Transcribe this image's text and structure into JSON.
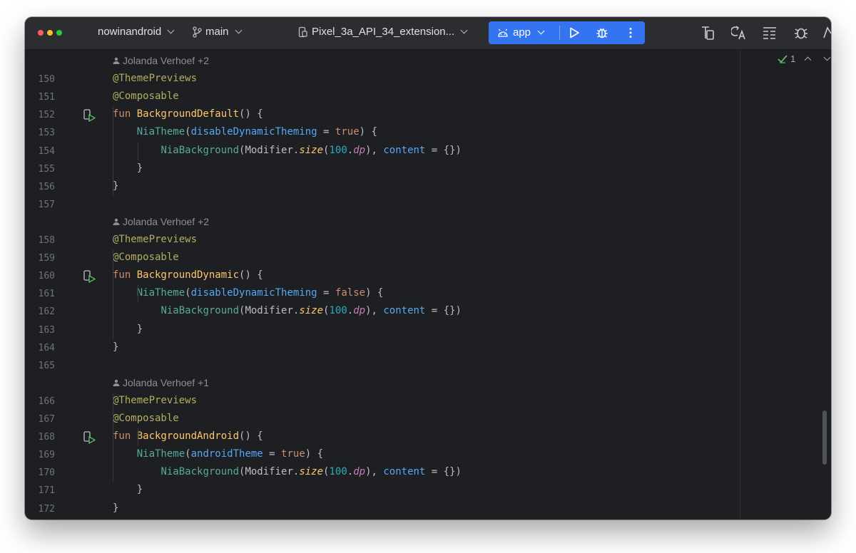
{
  "titlebar": {
    "project": "nowinandroid",
    "branch": "main",
    "device": "Pixel_3a_API_34_extension...",
    "run_config": "app"
  },
  "toolbar_icons": [
    "run-icon",
    "debug-icon",
    "more-icon",
    "device-manager-icon",
    "translate-icon",
    "code-structure-icon",
    "bug-icon",
    "profile-icon"
  ],
  "inspection": {
    "count": "1"
  },
  "author_blocks": [
    {
      "label": "Jolanda Verhoef +2"
    },
    {
      "label": "Jolanda Verhoef +2"
    },
    {
      "label": "Jolanda Verhoef +1"
    }
  ],
  "lines": [
    {
      "no": "150",
      "tokens": [
        [
          "@ThemePreviews",
          "ann"
        ]
      ]
    },
    {
      "no": "151",
      "tokens": [
        [
          "@Composable",
          "ann"
        ]
      ]
    },
    {
      "no": "152",
      "tokens": [
        [
          "fun ",
          "kw"
        ],
        [
          "BackgroundDefault",
          "fndecl"
        ],
        [
          "() {",
          "plain"
        ]
      ]
    },
    {
      "no": "153",
      "tokens": [
        [
          "    ",
          "plain"
        ],
        [
          "NiaTheme",
          "call"
        ],
        [
          "(",
          "plain"
        ],
        [
          "disableDynamicTheming",
          "param"
        ],
        [
          " = ",
          "plain"
        ],
        [
          "true",
          "kw"
        ],
        [
          ") {",
          "plain"
        ]
      ]
    },
    {
      "no": "154",
      "tokens": [
        [
          "        ",
          "plain"
        ],
        [
          "NiaBackground",
          "call"
        ],
        [
          "(Modifier.",
          "plain"
        ],
        [
          "size",
          "ital"
        ],
        [
          "(",
          "plain"
        ],
        [
          "100",
          "num"
        ],
        [
          ".",
          "plain"
        ],
        [
          "dp",
          "dp"
        ],
        [
          "), ",
          "plain"
        ],
        [
          "content",
          "param"
        ],
        [
          " = {})",
          "plain"
        ]
      ]
    },
    {
      "no": "155",
      "tokens": [
        [
          "    }",
          "plain"
        ]
      ]
    },
    {
      "no": "156",
      "tokens": [
        [
          "}",
          "plain"
        ]
      ]
    },
    {
      "no": "157",
      "tokens": []
    },
    {
      "no": "158",
      "tokens": [
        [
          "@ThemePreviews",
          "ann"
        ]
      ]
    },
    {
      "no": "159",
      "tokens": [
        [
          "@Composable",
          "ann"
        ]
      ]
    },
    {
      "no": "160",
      "tokens": [
        [
          "fun ",
          "kw"
        ],
        [
          "BackgroundDynamic",
          "fndecl"
        ],
        [
          "() {",
          "plain"
        ]
      ]
    },
    {
      "no": "161",
      "tokens": [
        [
          "    ",
          "plain"
        ],
        [
          "NiaTheme",
          "call"
        ],
        [
          "(",
          "plain"
        ],
        [
          "disableDynamicTheming",
          "param"
        ],
        [
          " = ",
          "plain"
        ],
        [
          "false",
          "kw"
        ],
        [
          ") {",
          "plain"
        ]
      ]
    },
    {
      "no": "162",
      "tokens": [
        [
          "        ",
          "plain"
        ],
        [
          "NiaBackground",
          "call"
        ],
        [
          "(Modifier.",
          "plain"
        ],
        [
          "size",
          "ital"
        ],
        [
          "(",
          "plain"
        ],
        [
          "100",
          "num"
        ],
        [
          ".",
          "plain"
        ],
        [
          "dp",
          "dp"
        ],
        [
          "), ",
          "plain"
        ],
        [
          "content",
          "param"
        ],
        [
          " = {})",
          "plain"
        ]
      ]
    },
    {
      "no": "163",
      "tokens": [
        [
          "    }",
          "plain"
        ]
      ]
    },
    {
      "no": "164",
      "tokens": [
        [
          "}",
          "plain"
        ]
      ]
    },
    {
      "no": "165",
      "tokens": []
    },
    {
      "no": "166",
      "tokens": [
        [
          "@ThemePreviews",
          "ann"
        ]
      ]
    },
    {
      "no": "167",
      "tokens": [
        [
          "@Composable",
          "ann"
        ]
      ]
    },
    {
      "no": "168",
      "tokens": [
        [
          "fun ",
          "kw"
        ],
        [
          "BackgroundAndroid",
          "fndecl"
        ],
        [
          "() {",
          "plain"
        ]
      ]
    },
    {
      "no": "169",
      "tokens": [
        [
          "    ",
          "plain"
        ],
        [
          "NiaTheme",
          "call"
        ],
        [
          "(",
          "plain"
        ],
        [
          "androidTheme",
          "param"
        ],
        [
          " = ",
          "plain"
        ],
        [
          "true",
          "kw"
        ],
        [
          ") {",
          "plain"
        ]
      ]
    },
    {
      "no": "170",
      "tokens": [
        [
          "        ",
          "plain"
        ],
        [
          "NiaBackground",
          "call"
        ],
        [
          "(Modifier.",
          "plain"
        ],
        [
          "size",
          "ital"
        ],
        [
          "(",
          "plain"
        ],
        [
          "100",
          "num"
        ],
        [
          ".",
          "plain"
        ],
        [
          "dp",
          "dp"
        ],
        [
          "), ",
          "plain"
        ],
        [
          "content",
          "param"
        ],
        [
          " = {})",
          "plain"
        ]
      ]
    },
    {
      "no": "171",
      "tokens": [
        [
          "    }",
          "plain"
        ]
      ]
    },
    {
      "no": "172",
      "tokens": [
        [
          "}",
          "plain"
        ]
      ]
    }
  ],
  "colors": {
    "accent": "#3574f0",
    "background": "#1e1f22",
    "titlebar": "#2b2d30"
  }
}
